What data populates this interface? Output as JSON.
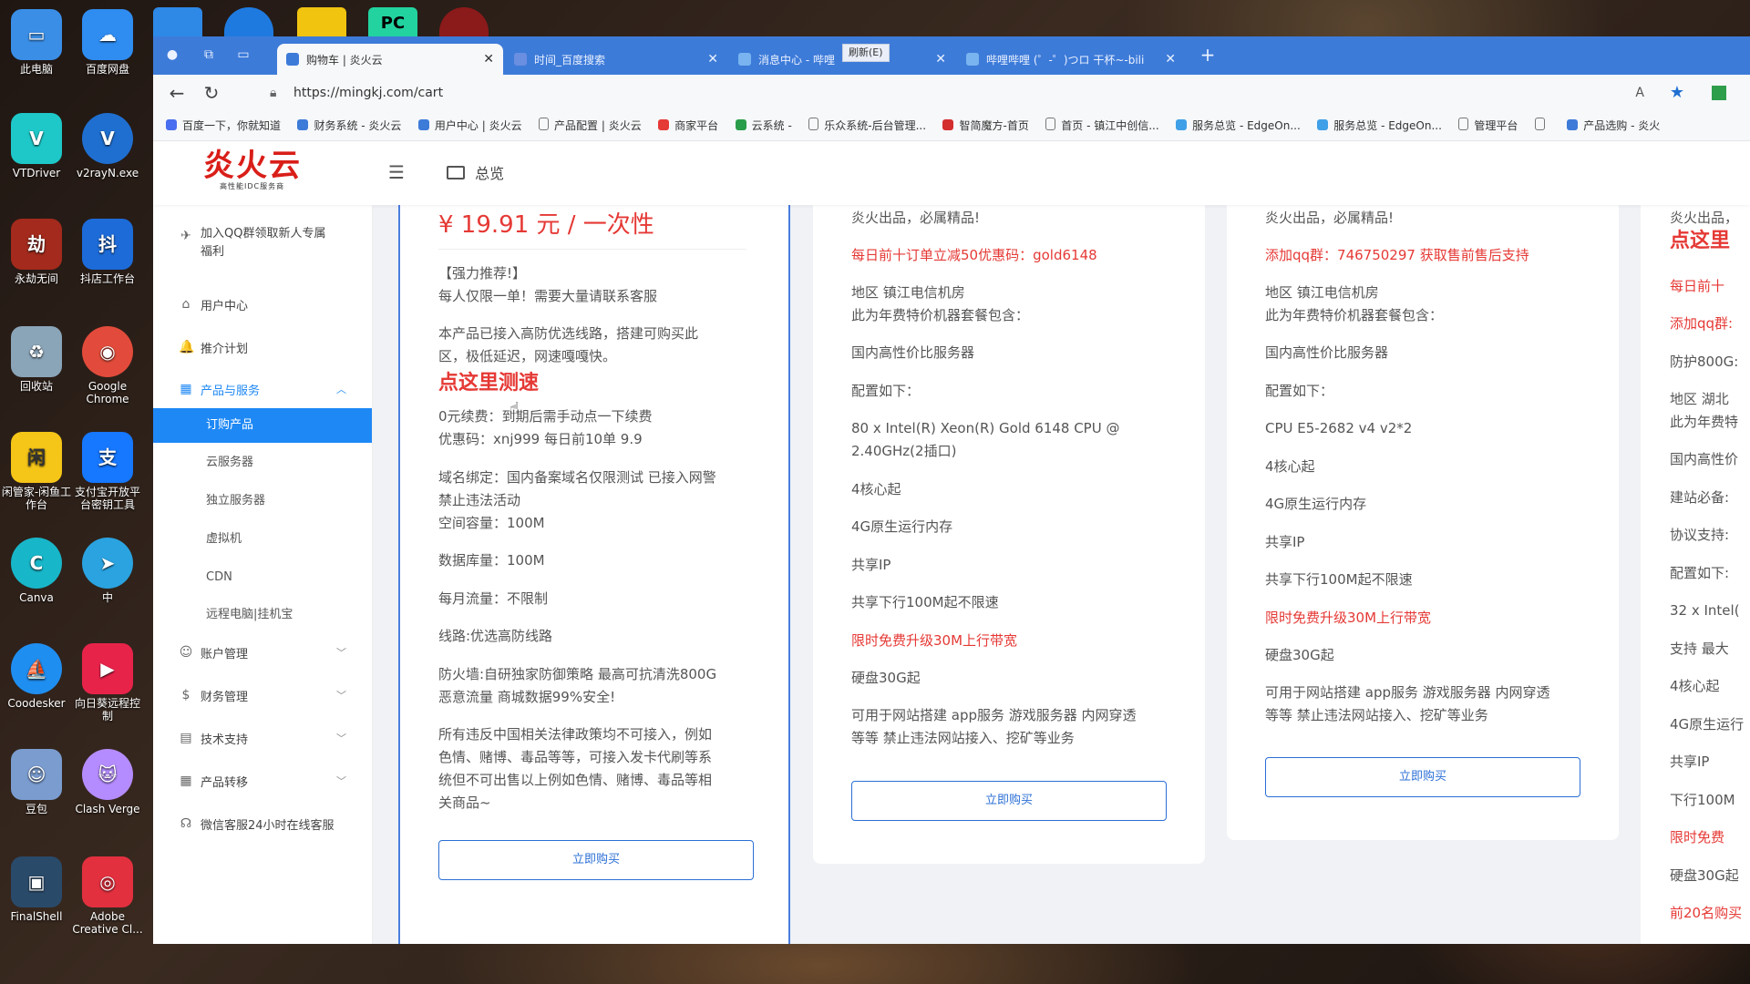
{
  "desktop": {
    "icons": [
      {
        "label": "此电脑",
        "color": "#3a8ee6",
        "glyph": "▭"
      },
      {
        "label": "百度网盘",
        "color": "#2f8cf0",
        "glyph": "☁"
      },
      {
        "label": "VTDriver",
        "color": "#1ec8c8",
        "glyph": "V"
      },
      {
        "label": "v2rayN.exe",
        "color": "#1f6fd1",
        "glyph": "V"
      },
      {
        "label": "永劫无间",
        "color": "#a32a1c",
        "glyph": "劫"
      },
      {
        "label": "抖店工作台",
        "color": "#1c6bd8",
        "glyph": "抖"
      },
      {
        "label": "回收站",
        "color": "#8aa4b8",
        "glyph": "♻"
      },
      {
        "label": "Google Chrome",
        "color": "#e24b3b",
        "glyph": "◉"
      },
      {
        "label": "闲管家-闲鱼工作台",
        "color": "#f5c518",
        "glyph": "闲"
      },
      {
        "label": "支付宝开放平台密钥工具",
        "color": "#1677ff",
        "glyph": "支"
      },
      {
        "label": "Canva",
        "color": "#18b6c9",
        "glyph": "C"
      },
      {
        "label": "中",
        "color": "#2aa3e0",
        "glyph": "➤"
      },
      {
        "label": "Coodesker",
        "color": "#1f8ef1",
        "glyph": "⛵"
      },
      {
        "label": "向日葵远程控制",
        "color": "#e8234a",
        "glyph": "▶"
      },
      {
        "label": "豆包",
        "color": "#7a9ccf",
        "glyph": "☺"
      },
      {
        "label": "Clash Verge",
        "color": "#b58cff",
        "glyph": "🐱"
      },
      {
        "label": "FinalShell",
        "color": "#2a4a6a",
        "glyph": "▣"
      },
      {
        "label": "Adobe Creative Cl...",
        "color": "#e2303f",
        "glyph": "◎"
      }
    ],
    "taskbar_icons": [
      {
        "label": "file-explorer",
        "color": "#2e88e6"
      },
      {
        "label": "edge",
        "color": "#1f7ae0"
      },
      {
        "label": "app-yellow",
        "color": "#f1c40f"
      },
      {
        "label": "pycharm",
        "color": "#22d3a0"
      },
      {
        "label": "game",
        "color": "#8b1a1a"
      }
    ]
  },
  "browser": {
    "tabs": [
      {
        "title": "购物车 | 炎火云",
        "active": true
      },
      {
        "title": "时间_百度搜索",
        "active": false
      },
      {
        "title": "消息中心 - 哔哩",
        "active": false
      },
      {
        "title": "哔哩哔哩 (゜-゜)つロ 干杯~-bili",
        "active": false
      }
    ],
    "tab_tooltip": "刷新(E)",
    "new_tab_symbol": "+",
    "url": "https://mingkj.com/cart",
    "bookmarks": [
      "百度一下，你就知道",
      "财务系统 - 炎火云",
      "用户中心 | 炎火云",
      "产品配置 | 炎火云",
      "商家平台",
      "云系统 -",
      "乐众系统-后台管理...",
      "智简魔方-首页",
      "首页 - 镇江中创信...",
      "服务总览 - EdgeOn...",
      "服务总览 - EdgeOn...",
      "管理平台",
      "",
      "产品选购 - 炎火"
    ]
  },
  "header": {
    "logo_text": "炎火云",
    "logo_sub": "高性能IDC服务商",
    "menu_icon": "☰",
    "overview_label": "总览"
  },
  "sidebar": {
    "items": [
      {
        "label": "加入QQ群领取新人专属福利",
        "icon": "✈"
      },
      {
        "label": "用户中心",
        "icon": "⌂"
      },
      {
        "label": "推介计划",
        "icon": "🔔"
      },
      {
        "label": "产品与服务",
        "icon": "▦",
        "open": true
      },
      {
        "label": "账户管理",
        "icon": "☺"
      },
      {
        "label": "财务管理",
        "icon": "$"
      },
      {
        "label": "技术支持",
        "icon": "▤"
      },
      {
        "label": "产品转移",
        "icon": "▦"
      },
      {
        "label": "微信客服24小时在线客服",
        "icon": "☊"
      }
    ],
    "sub_items": [
      {
        "label": "订购产品",
        "active": true
      },
      {
        "label": "云服务器",
        "active": false
      },
      {
        "label": "独立服务器",
        "active": false
      },
      {
        "label": "虚拟机",
        "active": false
      },
      {
        "label": "CDN",
        "active": false
      },
      {
        "label": "远程电脑|挂机宝",
        "active": false
      }
    ]
  },
  "cards": {
    "card1": {
      "price": "¥ 19.91 元 / 一次性",
      "lines": [
        "【强力推荐!】",
        "每人仅限一单！需要大量请联系客服",
        "本产品已接入高防优选线路，搭建可购买此",
        "区，极低延迟，网速嘎嘎快。",
        "点这里测速",
        "0元续费：到期后需手动点一下续费",
        "优惠码：xnj999 每日前10单 9.9",
        "域名绑定：国内备案域名仅限测试 已接入网警",
        "禁止违法活动",
        "空间容量：100M",
        "数据库量：100M",
        "每月流量：不限制",
        "线路:优选高防线路",
        "防火墙:自研独家防御策略 最高可抗清洗800G",
        "恶意流量 商城数据99%安全!",
        "所有违反中国相关法律政策均不可接入，例如",
        "色情、赌博、毒品等等，可接入发卡代刷等系",
        "统但不可出售以上例如色情、赌博、毒品等相",
        "关商品~"
      ],
      "buy_label": "立即购买"
    },
    "card2": {
      "lines": [
        "炎火出品，必属精品!",
        "每日前十订单立减50优惠码：gold6148",
        "地区 镇江电信机房",
        "此为年费特价机器套餐包含：",
        "国内高性价比服务器",
        "配置如下：",
        "80 x Intel(R) Xeon(R) Gold 6148 CPU @",
        "2.40GHz(2插口)",
        "4核心起",
        "4G原生运行内存",
        "共享IP",
        "共享下行100M起不限速",
        "限时免费升级30M上行带宽",
        "硬盘30G起",
        "可用于网站搭建 app服务 游戏服务器 内网穿透",
        "等等 禁止违法网站接入、挖矿等业务"
      ],
      "buy_label": "立即购买"
    },
    "card3": {
      "lines": [
        "炎火出品，必属精品!",
        "添加qq群：746750297 获取售前售后支持",
        "地区 镇江电信机房",
        "此为年费特价机器套餐包含：",
        "国内高性价比服务器",
        "配置如下：",
        "CPU E5-2682 v4 v2*2",
        "4核心起",
        "4G原生运行内存",
        "共享IP",
        "共享下行100M起不限速",
        "限时免费升级30M上行带宽",
        "硬盘30G起",
        "可用于网站搭建 app服务 游戏服务器 内网穿透",
        "等等 禁止违法网站接入、挖矿等业务"
      ],
      "buy_label": "立即购买"
    },
    "card4": {
      "lines": [
        "炎火出品，",
        "点这里",
        "每日前十",
        "添加qq群:",
        "防护800G:",
        "地区 湖北",
        "此为年费特",
        "国内高性价",
        "建站必备:",
        "协议支持:",
        "配置如下:",
        "32 x Intel(",
        "支持 最大",
        "4核心起",
        "4G原生运行",
        "共享IP",
        "下行100M",
        "限时免费",
        "硬盘30G起",
        "前20名购买"
      ]
    }
  },
  "colors": {
    "accent": "#1e88f5",
    "red": "#e53935",
    "tabbar": "#3d7bd9"
  }
}
